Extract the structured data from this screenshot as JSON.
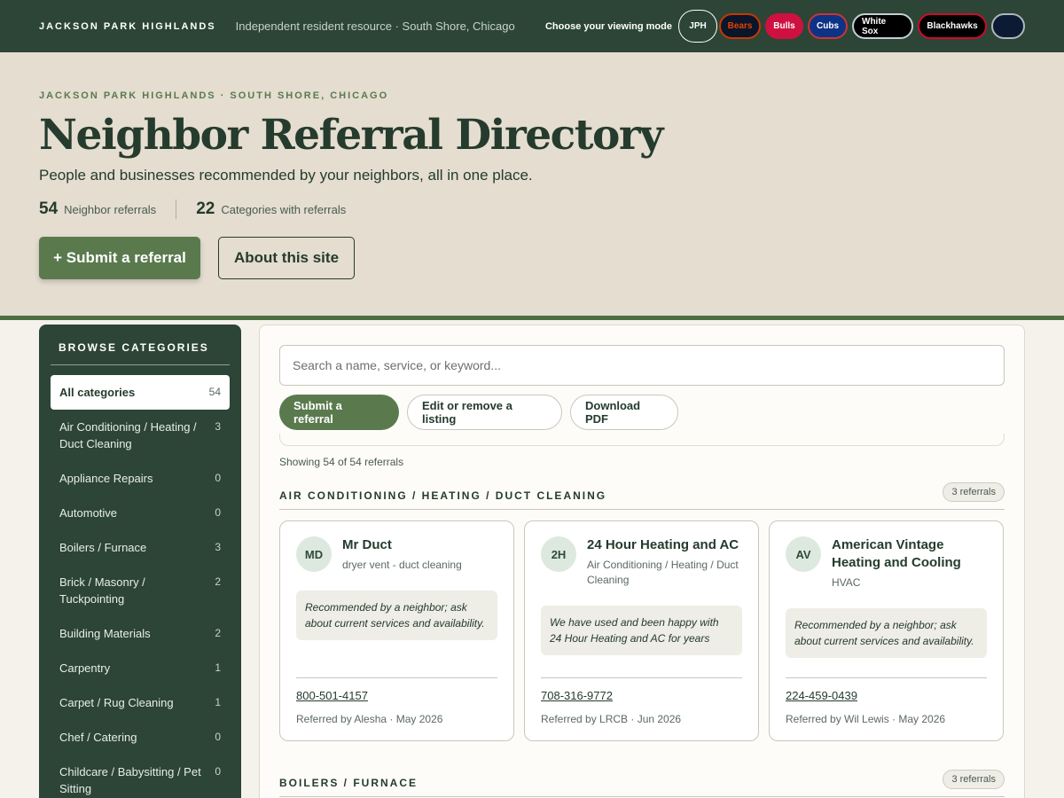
{
  "topbar": {
    "brand": "JACKSON PARK HIGHLANDS",
    "tagline": "Independent resident resource · South Shore, Chicago",
    "mode_label": "Choose your viewing mode",
    "modes": [
      {
        "label": "JPH",
        "bg": "#2c4536",
        "fg": "#ffffff",
        "border": "#2c4536"
      },
      {
        "label": "Bears",
        "bg": "#0b162a",
        "fg": "#e64100",
        "border": "#c83803"
      },
      {
        "label": "Bulls",
        "bg": "#ce1141",
        "fg": "#ffffff",
        "border": "#ce1141"
      },
      {
        "label": "Cubs",
        "bg": "#0e3386",
        "fg": "#ffffff",
        "border": "#cc3433"
      },
      {
        "label": "White Sox",
        "bg": "#000000",
        "fg": "#ffffff",
        "border": "#c4ced4"
      },
      {
        "label": "Blackhawks",
        "bg": "#000000",
        "fg": "#ffffff",
        "border": "#cf0a2c"
      },
      {
        "label": "",
        "bg": "#0c1b33",
        "fg": "#ffffff",
        "border": "#b0b7bc"
      }
    ]
  },
  "hero": {
    "eyebrow": "JACKSON PARK HIGHLANDS · SOUTH SHORE, CHICAGO",
    "title": "Neighbor Referral Directory",
    "subtitle": "People and businesses recommended by your neighbors, all in one place.",
    "stats": [
      {
        "num": "54",
        "label": "Neighbor referrals"
      },
      {
        "num": "22",
        "label": "Categories with referrals"
      }
    ],
    "primary_button": "+ Submit a referral",
    "secondary_button": "About this site"
  },
  "sidebar": {
    "heading": "BROWSE CATEGORIES",
    "items": [
      {
        "label": "All categories",
        "count": "54",
        "active": true
      },
      {
        "label": "Air Conditioning / Heating / Duct Cleaning",
        "count": "3"
      },
      {
        "label": "Appliance Repairs",
        "count": "0"
      },
      {
        "label": "Automotive",
        "count": "0"
      },
      {
        "label": "Boilers / Furnace",
        "count": "3"
      },
      {
        "label": "Brick / Masonry / Tuckpointing",
        "count": "2"
      },
      {
        "label": "Building Materials",
        "count": "2"
      },
      {
        "label": "Carpentry",
        "count": "1"
      },
      {
        "label": "Carpet / Rug Cleaning",
        "count": "1"
      },
      {
        "label": "Chef / Catering",
        "count": "0"
      },
      {
        "label": "Childcare / Babysitting / Pet Sitting",
        "count": "0"
      }
    ]
  },
  "main": {
    "search_placeholder": "Search a name, service, or keyword...",
    "actions": {
      "submit": "Submit a referral",
      "edit": "Edit or remove a listing",
      "download": "Download PDF"
    },
    "showing": "Showing 54 of 54 referrals",
    "sections": [
      {
        "title": "AIR CONDITIONING / HEATING / DUCT CLEANING",
        "count": "3 referrals",
        "cards": [
          {
            "initials": "MD",
            "name": "Mr Duct",
            "category": "dryer vent - duct cleaning",
            "quote": "Recommended by a neighbor; ask about current services and availability.",
            "phone": "800-501-4157",
            "referrer": "Referred by Alesha · May 2026"
          },
          {
            "initials": "2H",
            "name": "24 Hour Heating and AC",
            "category": "Air Conditioning / Heating / Duct Cleaning",
            "quote": "We have used and been happy with 24 Hour Heating and AC for years",
            "phone": "708-316-9772",
            "referrer": "Referred by LRCB · Jun 2026"
          },
          {
            "initials": "AV",
            "name": "American Vintage Heating and Cooling",
            "category": "HVAC",
            "quote": "Recommended by a neighbor; ask about current services and availability.",
            "phone": "224-459-0439",
            "referrer": "Referred by Wil Lewis · May 2026"
          }
        ]
      },
      {
        "title": "BOILERS / FURNACE",
        "count": "3 referrals"
      }
    ]
  }
}
